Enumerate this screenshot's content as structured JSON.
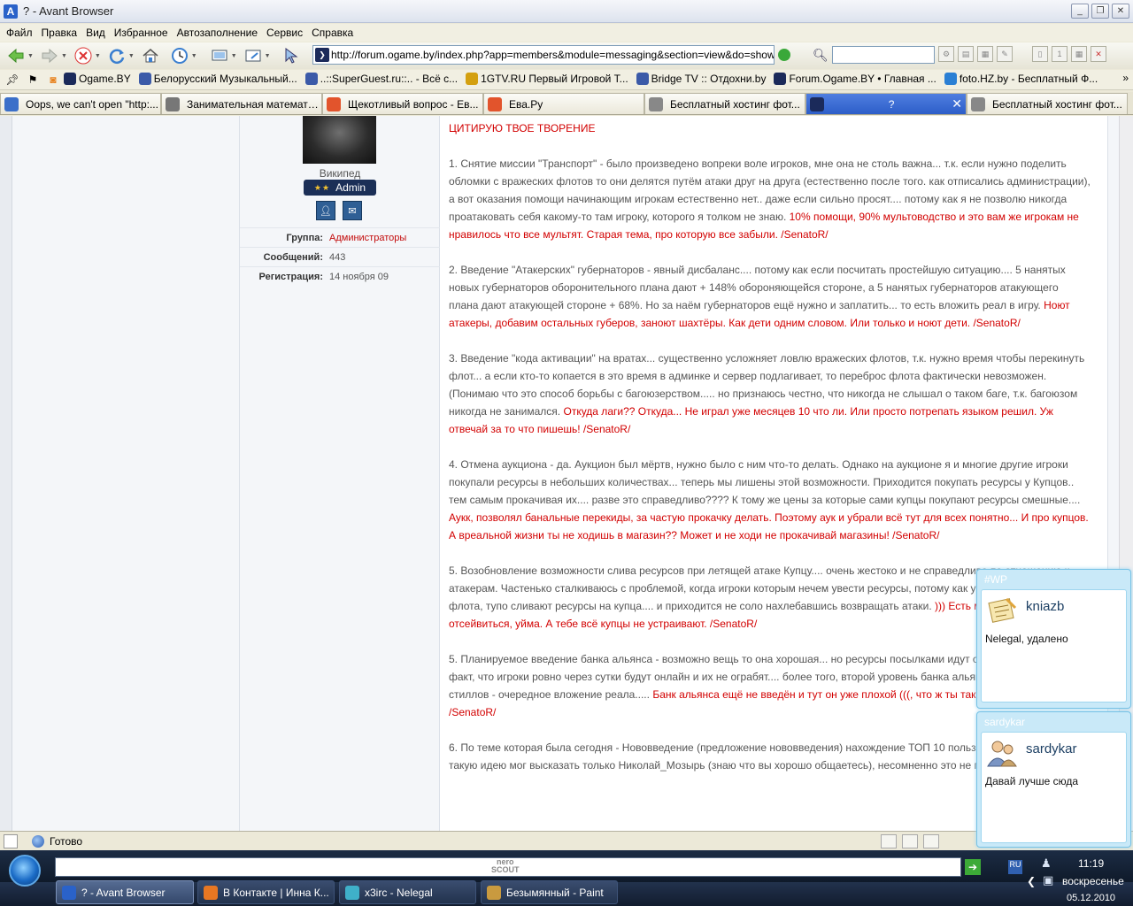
{
  "window": {
    "title": "? - Avant Browser",
    "app_letter": "A"
  },
  "menu": [
    "Файл",
    "Правка",
    "Вид",
    "Избранное",
    "Автозаполнение",
    "Сервис",
    "Справка"
  ],
  "address": {
    "url": "http://forum.ogame.by/index.php?app=members&module=messaging&section=view&do=showConvers"
  },
  "favorites": [
    {
      "label": "Ogame.BY",
      "color": "#1b2a5a"
    },
    {
      "label": "Белорусский Музыкальный...",
      "color": "#3b5aa8"
    },
    {
      "label": "..::SuperGuest.ru::.. - Всё с...",
      "color": "#3b5aa8"
    },
    {
      "label": "1GTV.RU Первый Игровой Т...",
      "color": "#d4a010"
    },
    {
      "label": "Bridge TV :: Отдохни.by",
      "color": "#3b5aa8"
    },
    {
      "label": "Forum.Ogame.BY • Главная ...",
      "color": "#1b2a5a"
    },
    {
      "label": "foto.HZ.by - Бесплатный Ф...",
      "color": "#2a7fd4"
    }
  ],
  "tabs": [
    {
      "label": "Oops, we can't open \"http:...",
      "color": "#3b6fc9",
      "active": false
    },
    {
      "label": "Занимательная математи...",
      "color": "#777",
      "active": false
    },
    {
      "label": "Щекотливый вопрос - Ев...",
      "color": "#e2542c",
      "active": false
    },
    {
      "label": "Ева.Ру",
      "color": "#e2542c",
      "active": false
    },
    {
      "label": "Бесплатный хостинг фот...",
      "color": "#888",
      "active": false
    },
    {
      "label": "?",
      "color": "#1b2a5a",
      "active": true
    },
    {
      "label": "Бесплатный хостинг фот...",
      "color": "#888",
      "active": false
    }
  ],
  "author": {
    "name": "Википед",
    "rank": "Admin",
    "stars": "★★",
    "info": [
      {
        "label": "Группа:",
        "value": "Администраторы",
        "highlight": true
      },
      {
        "label": "Сообщений:",
        "value": "443",
        "highlight": false
      },
      {
        "label": "Регистрация:",
        "value": "14 ноября 09",
        "highlight": false
      }
    ]
  },
  "post": {
    "quote_header": "ЦИТИРУЮ ТВОЕ ТВОРЕНИЕ",
    "paragraphs": [
      {
        "text": "1. Снятие миссии \"Транспорт\" - было произведено вопреки воле игроков, мне она не столь важна... т.к. если нужно поделить обломки с вражеских флотов то они делятся путём атаки друг на друга (естественно после того. как отписались администрации), а вот оказания помощи начинающим игрокам естественно нет.. даже если сильно просят.... потому как я не позволю никогда проатаковать себя какому-то там игроку, которого я толком не знаю.",
        "reply": "10% помощи, 90% мультоводство и это вам же игрокам не нравилось что все мультят. Старая тема, про которую все забыли. /SenatoR/"
      },
      {
        "text": "2. Введение \"Атакерских\" губернаторов - явный дисбаланс.... потому как если посчитать простейшую ситуацию.... 5 нанятых новых губернаторов оборонительного плана дают + 148% обороняющейся стороне, а 5 нанятых губернаторов атакующего плана дают атакующей стороне + 68%. Но за наём губернаторов ещё нужно и заплатить... то есть вложить реал в игру.",
        "reply": "Ноют атакеры, добавим остальных губеров, заноют шахтёры. Как дети одним словом. Или только и ноют дети. /SenatoR/"
      },
      {
        "text": "3. Введение \"кода активации\" на вратах... существенно усложняет ловлю вражеских флотов, т.к. нужно время чтобы перекинуть флот... а если кто-то копается в это время в админке и сервер подлагивает, то переброс флота фактически невозможен. (Понимаю что это способ борьбы с багоюзерством..... но признаюсь честно, что никогда не слышал о таком баге, т.к. багоюзом никогда не занимался.",
        "reply": "Откуда лаги?? Откуда... Не играл уже месяцев 10 что ли. Или просто потрепать языком решил. Уж отвечай за то что пишешь! /SenatoR/"
      },
      {
        "text": "4. Отмена аукциона - да. Аукцион был мёртв, нужно было с ним что-то делать. Однако на аукционе я и многие другие игроки покупали ресурсы в небольших количествах... теперь мы лишены этой возможности. Приходится покупать ресурсы у Купцов.. тем самым прокачивая их.... разве это справедливо???? К тому же цены за которые сами купцы покупают ресурсы смешные....",
        "reply": "Аукк, позволял банальные перекиды, за частую прокачку делать. Поэтому аук и убрали всё тут для всех понятно... И про купцов. А вреальной жизни ты не ходишь в магазин?? Может и не ходи не прокачивай магазины! /SenatoR/"
      },
      {
        "text": "5. Возобновление возможности слива ресурсов при летящей атаке Купцу.... очень жестоко и не справедливо по отношению к атакерам. Частенько сталкиваюсь с проблемой, когда игроки которым нечем увести ресурсы, потому как у них нет транспортного флота, тупо сливают ресурсы на купца.... и приходится не соло нахлебавшись возвращать атаки.",
        "reply": "))) Есть много других способов отсейвиться, уйма. А тебе всё купцы не устраивают. /SenatoR/"
      },
      {
        "text": "5. Планируемое введение банка альянса - возможно вещь то она хорошая... но ресурсы посылками идут сутки.... далеко не факт, что игроки ровно через сутки будут онлайн и их не ограбят.... более того, второй уровень банка альянса стоит 1800 стиллов - очередное вложение реала.....",
        "reply": "Банк альянса ещё не введён и тут он уже плохой (((, что ж ты так. Само недавольство... /SenatoR/"
      },
      {
        "text": "6. По теме которая была сегодня - Нововведение (предложение нововведения) нахождение ТОП 10 пользователей... думаю такую идею мог высказать только Николай_Мозырь (знаю что вы хорошо общаетесь), несомненно это не плохая идея...",
        "reply": ""
      }
    ]
  },
  "status": {
    "text": "Готово"
  },
  "chats": [
    {
      "title": "#WP",
      "user": "kniazb",
      "message": "Nelegal,  удалено"
    },
    {
      "title": "sardykar",
      "user": "sardykar",
      "message": "Давай лучше сюда"
    }
  ],
  "quick_launch": {
    "nero_line1": "nero",
    "nero_line2": "SCOUT"
  },
  "taskbar": [
    {
      "label": "? - Avant Browser",
      "color": "#2a62c9",
      "active": true
    },
    {
      "label": "В Контакте | Инна К...",
      "color": "#e87722",
      "active": false
    },
    {
      "label": "x3irc - Nelegal",
      "color": "#3fb0c9",
      "active": false
    },
    {
      "label": "Безымянный - Paint",
      "color": "#c99a3f",
      "active": false
    }
  ],
  "clock": {
    "time": "11:19",
    "day": "воскресенье",
    "date": "05.12.2010"
  }
}
